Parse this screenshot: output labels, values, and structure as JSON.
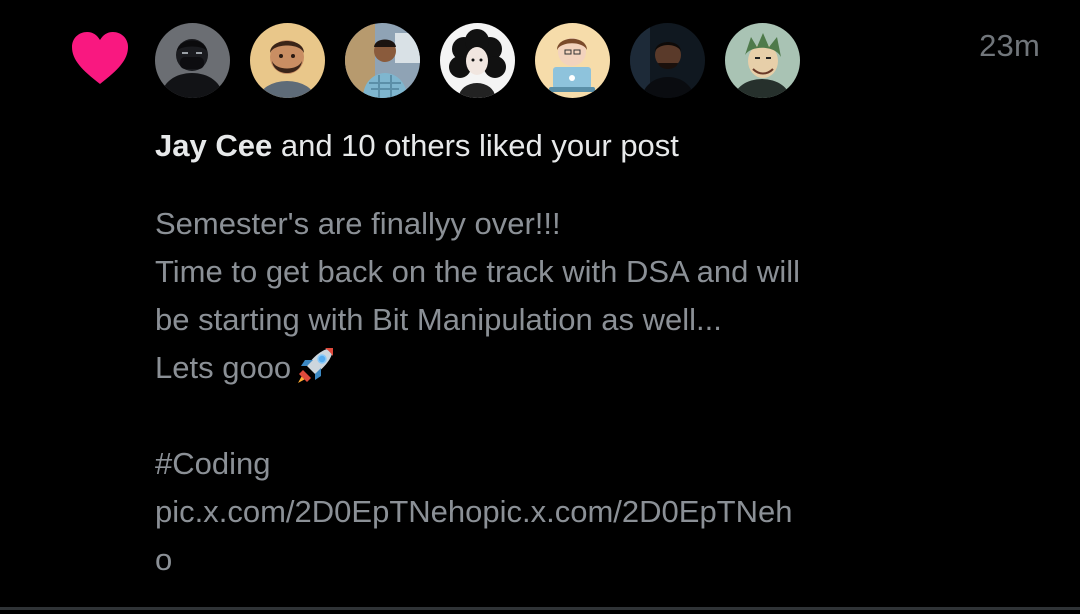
{
  "notification": {
    "type_icon": "heart-icon",
    "accent_color": "#f91880",
    "timestamp": "23m",
    "actor_name": "Jay Cee",
    "summary_rest": " and 10 others liked your post",
    "avatars": [
      {
        "name": "avatar-masked-person"
      },
      {
        "name": "avatar-bearded-cartoon"
      },
      {
        "name": "avatar-man-outdoors"
      },
      {
        "name": "avatar-curly-hair-girl"
      },
      {
        "name": "avatar-laptop-cartoon"
      },
      {
        "name": "avatar-man-dark"
      },
      {
        "name": "avatar-anime-green-hair"
      }
    ]
  },
  "post": {
    "line1": "Semester's are finallyy over!!!",
    "line2": "Time to get back on the track with DSA and will",
    "line3": "be starting with Bit Manipulation as well...",
    "line4": "Lets gooo",
    "emoji": "rocket-icon",
    "hashtag": "#Coding",
    "link_line1": "pic.x.com/2D0EpTNehopic.x.com/2D0EpTNeh",
    "link_line2": "o"
  }
}
